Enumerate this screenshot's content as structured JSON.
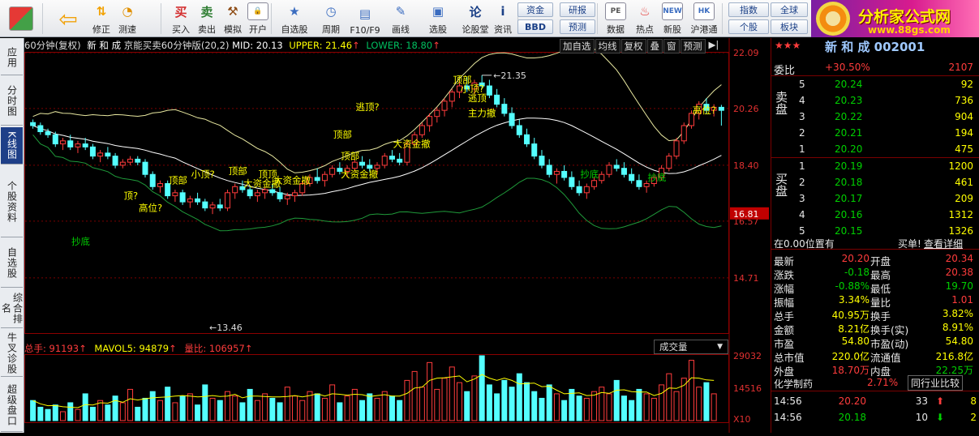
{
  "toolbar": {
    "buttons": [
      {
        "label": "修正",
        "icon": "arrow-up-down-icon"
      },
      {
        "label": "测速",
        "icon": "clock-icon"
      },
      {
        "label": "买入",
        "icon": "buy-icon"
      },
      {
        "label": "卖出",
        "icon": "sell-icon"
      },
      {
        "label": "模拟",
        "icon": "hammer-icon"
      },
      {
        "label": "开户",
        "icon": "lock-icon"
      },
      {
        "label": "自选股",
        "icon": "star-icon"
      },
      {
        "label": "周期",
        "icon": "clock-icon"
      },
      {
        "label": "F10/F9",
        "icon": "f10-icon"
      },
      {
        "label": "画线",
        "icon": "pen-icon"
      },
      {
        "label": "选股",
        "icon": "chart-select-icon"
      },
      {
        "label": "论股堂",
        "icon": "forum-icon"
      },
      {
        "label": "资讯",
        "icon": "info-icon"
      },
      {
        "label": "数据",
        "icon": "pe-icon"
      },
      {
        "label": "热点",
        "icon": "fire-icon"
      },
      {
        "label": "新股",
        "icon": "newstock-icon"
      },
      {
        "label": "沪港通",
        "icon": "hk-icon"
      }
    ],
    "small_buttons": [
      "资金",
      "BBD",
      "研报",
      "预测",
      "指数",
      "个股",
      "全球",
      "板块"
    ],
    "brand_title": "分析家公式网",
    "brand_url": "www.88gs.com",
    "zoom_icons": [
      "×",
      "1",
      "2",
      "3"
    ]
  },
  "sidebar": [
    "应用",
    "分时图",
    "K线图",
    "个股资料",
    "自选股",
    "综合排名",
    "牛叉诊股",
    "超级盘口"
  ],
  "chart_header": {
    "period": "60分钟(复权)",
    "stock": "新 和 成",
    "indicator": "京能买卖60分钟版(20,2)",
    "mid": "MID: 20.13",
    "upper": "UPPER: 21.46",
    "lower": "LOWER: 18.80",
    "buttons": [
      "加自选",
      "均线",
      "复权",
      "叠",
      "窗",
      "预测"
    ]
  },
  "price_axis": [
    "22.09",
    "20.26",
    "18.40",
    "16.57",
    "14.71"
  ],
  "current_price_tag": "16.81",
  "annotations": {
    "high": "21.35",
    "low": "13.46"
  },
  "signal_labels": [
    "抄底",
    "顶?",
    "高位?",
    "顶部",
    "小顶?",
    "顶部",
    "大资金撤",
    "顶顶",
    "大资金撤",
    "顶部",
    "逃顶?",
    "顶部",
    "大资金撤",
    "大资金撤",
    "顶部",
    "小顶?",
    "逃顶",
    "主力撤",
    "抄底",
    "抄底",
    "高位?"
  ],
  "volume_header": {
    "total": "总手: 91193",
    "mavol": "MAVOL5: 94879",
    "ratio": "量比: 106957",
    "dropdown": "成交量"
  },
  "volume_axis": [
    "29032",
    "14516",
    "X10"
  ],
  "quote": {
    "title": "新 和 成  002001",
    "weibi": {
      "label": "委比",
      "value": "+30.50%",
      "diff": "2107"
    },
    "sell_label": "卖盘",
    "buy_label": "买盘",
    "sell": [
      [
        "5",
        "20.24",
        "92"
      ],
      [
        "4",
        "20.23",
        "736"
      ],
      [
        "3",
        "20.22",
        "904"
      ],
      [
        "2",
        "20.21",
        "194"
      ],
      [
        "1",
        "20.20",
        "475"
      ]
    ],
    "buy": [
      [
        "1",
        "20.19",
        "1200"
      ],
      [
        "2",
        "20.18",
        "461"
      ],
      [
        "3",
        "20.17",
        "209"
      ],
      [
        "4",
        "20.16",
        "1312"
      ],
      [
        "5",
        "20.15",
        "1326"
      ]
    ],
    "position": "在0.00位置有",
    "buy_one": "买单!",
    "detail": "查看详细",
    "stats_left": [
      [
        "最新",
        "20.20"
      ],
      [
        "涨跌",
        "-0.18"
      ],
      [
        "涨幅",
        "-0.88%"
      ],
      [
        "振幅",
        "3.34%"
      ],
      [
        "总手",
        "40.95万"
      ],
      [
        "金额",
        "8.21亿"
      ],
      [
        "市盈",
        "54.80"
      ],
      [
        "总市值",
        "220.0亿"
      ],
      [
        "外盘",
        "18.70万"
      ]
    ],
    "stats_right": [
      [
        "开盘",
        "20.34"
      ],
      [
        "最高",
        "20.38"
      ],
      [
        "最低",
        "19.70"
      ],
      [
        "量比",
        "1.01"
      ],
      [
        "换手",
        "3.82%"
      ],
      [
        "换手(实)",
        "8.91%"
      ],
      [
        "市盈(动)",
        "54.80"
      ],
      [
        "流通值",
        "216.8亿"
      ],
      [
        "内盘",
        "22.25万"
      ]
    ],
    "industry": {
      "name": "化学制药",
      "pct": "2.71%",
      "compare": "同行业比较"
    },
    "ticks": [
      [
        "14:56",
        "20.20",
        "33",
        "8"
      ],
      [
        "14:56",
        "20.18",
        "10",
        "2"
      ]
    ]
  },
  "chart_data": {
    "type": "candlestick",
    "price_range": [
      12.9,
      22.09
    ],
    "volume_range": [
      0,
      29032
    ],
    "candles": [
      [
        19.8,
        19.9,
        19.6,
        19.7
      ],
      [
        19.7,
        19.8,
        19.4,
        19.5
      ],
      [
        19.5,
        19.6,
        19.3,
        19.4
      ],
      [
        19.4,
        19.5,
        19.0,
        19.1
      ],
      [
        19.1,
        19.3,
        18.9,
        19.2
      ],
      [
        19.2,
        19.4,
        18.9,
        19.0
      ],
      [
        19.0,
        19.2,
        18.8,
        19.1
      ],
      [
        19.1,
        19.3,
        18.9,
        19.0
      ],
      [
        19.0,
        19.1,
        18.6,
        18.7
      ],
      [
        18.7,
        18.9,
        18.5,
        18.8
      ],
      [
        18.8,
        19.0,
        18.6,
        18.7
      ],
      [
        18.7,
        18.8,
        18.3,
        18.4
      ],
      [
        18.4,
        18.6,
        18.3,
        18.5
      ],
      [
        18.5,
        18.7,
        18.4,
        18.6
      ],
      [
        18.6,
        18.7,
        18.4,
        18.5
      ],
      [
        18.5,
        18.6,
        18.0,
        18.1
      ],
      [
        18.1,
        18.2,
        17.6,
        17.7
      ],
      [
        17.7,
        17.9,
        17.5,
        17.8
      ],
      [
        17.8,
        17.9,
        17.3,
        17.4
      ],
      [
        17.4,
        17.6,
        17.2,
        17.5
      ],
      [
        17.5,
        17.6,
        17.1,
        17.2
      ],
      [
        17.2,
        17.4,
        17.0,
        17.3
      ],
      [
        17.3,
        17.5,
        17.1,
        17.2
      ],
      [
        17.2,
        17.3,
        16.9,
        17.0
      ],
      [
        17.0,
        17.2,
        16.8,
        17.1
      ],
      [
        17.1,
        17.3,
        16.9,
        17.0
      ],
      [
        17.0,
        17.6,
        16.9,
        17.5
      ],
      [
        17.5,
        17.8,
        17.3,
        17.7
      ],
      [
        17.7,
        17.9,
        17.5,
        17.6
      ],
      [
        17.6,
        17.7,
        17.3,
        17.4
      ],
      [
        17.4,
        17.6,
        17.2,
        17.5
      ],
      [
        17.5,
        17.7,
        17.3,
        17.6
      ],
      [
        17.6,
        17.8,
        17.4,
        17.5
      ],
      [
        17.5,
        17.7,
        17.2,
        17.3
      ],
      [
        17.3,
        17.5,
        17.1,
        17.4
      ],
      [
        17.4,
        17.6,
        17.2,
        17.5
      ],
      [
        17.5,
        17.9,
        17.4,
        17.8
      ],
      [
        17.8,
        18.1,
        17.7,
        18.0
      ],
      [
        18.0,
        18.3,
        17.8,
        17.9
      ],
      [
        17.9,
        18.2,
        17.7,
        18.1
      ],
      [
        18.1,
        18.4,
        18.0,
        18.3
      ],
      [
        18.3,
        18.5,
        18.1,
        18.2
      ],
      [
        18.2,
        18.4,
        18.0,
        18.3
      ],
      [
        18.3,
        18.6,
        18.2,
        18.5
      ],
      [
        18.5,
        18.7,
        18.3,
        18.4
      ],
      [
        18.4,
        18.6,
        18.2,
        18.3
      ],
      [
        18.3,
        18.5,
        18.1,
        18.4
      ],
      [
        18.4,
        18.8,
        18.3,
        18.7
      ],
      [
        18.7,
        18.9,
        18.5,
        18.6
      ],
      [
        18.6,
        18.8,
        18.4,
        18.5
      ],
      [
        18.5,
        19.2,
        18.4,
        19.1
      ],
      [
        19.1,
        19.5,
        19.0,
        19.4
      ],
      [
        19.4,
        19.8,
        19.3,
        19.7
      ],
      [
        19.7,
        20.1,
        19.5,
        20.0
      ],
      [
        20.0,
        20.3,
        19.8,
        20.2
      ],
      [
        20.2,
        20.6,
        20.0,
        20.5
      ],
      [
        20.5,
        20.9,
        20.3,
        20.8
      ],
      [
        20.8,
        21.2,
        20.6,
        21.0
      ],
      [
        21.0,
        21.3,
        20.8,
        20.9
      ],
      [
        20.9,
        21.2,
        20.7,
        21.1
      ],
      [
        21.1,
        21.35,
        20.9,
        21.0
      ],
      [
        21.0,
        21.2,
        20.6,
        20.7
      ],
      [
        20.7,
        20.9,
        20.3,
        20.4
      ],
      [
        20.4,
        20.6,
        20.0,
        20.1
      ],
      [
        20.1,
        20.3,
        19.6,
        19.7
      ],
      [
        19.7,
        19.9,
        19.3,
        19.4
      ],
      [
        19.4,
        19.6,
        19.0,
        19.1
      ],
      [
        19.1,
        19.3,
        18.6,
        18.7
      ],
      [
        18.7,
        18.9,
        18.3,
        18.4
      ],
      [
        18.4,
        18.6,
        18.0,
        18.1
      ],
      [
        18.1,
        18.3,
        17.8,
        18.2
      ],
      [
        18.2,
        18.4,
        17.9,
        18.0
      ],
      [
        18.0,
        18.2,
        17.6,
        17.7
      ],
      [
        17.7,
        17.9,
        17.4,
        17.5
      ],
      [
        17.5,
        17.8,
        17.3,
        17.7
      ],
      [
        17.7,
        18.0,
        17.6,
        17.9
      ],
      [
        17.9,
        18.2,
        17.8,
        18.1
      ],
      [
        18.1,
        18.5,
        18.0,
        18.4
      ],
      [
        18.4,
        18.6,
        18.2,
        18.3
      ],
      [
        18.3,
        18.5,
        18.0,
        18.1
      ],
      [
        18.1,
        18.3,
        17.8,
        17.9
      ],
      [
        17.9,
        18.1,
        17.6,
        17.7
      ],
      [
        17.7,
        17.9,
        17.5,
        17.8
      ],
      [
        17.8,
        18.1,
        17.7,
        18.0
      ],
      [
        18.0,
        18.4,
        17.9,
        18.3
      ],
      [
        18.3,
        18.8,
        18.2,
        18.7
      ],
      [
        18.7,
        19.3,
        18.6,
        19.2
      ],
      [
        19.2,
        19.8,
        19.1,
        19.7
      ],
      [
        19.7,
        20.2,
        19.6,
        20.1
      ],
      [
        20.1,
        20.5,
        19.9,
        20.4
      ],
      [
        20.4,
        20.6,
        20.1,
        20.2
      ],
      [
        20.2,
        20.4,
        20.0,
        20.3
      ],
      [
        20.3,
        20.38,
        19.7,
        20.2
      ]
    ],
    "volumes": [
      9000,
      6000,
      5000,
      7000,
      4000,
      8000,
      5000,
      12000,
      6000,
      9000,
      7000,
      11000,
      8000,
      14000,
      6000,
      10000,
      13000,
      9000,
      15000,
      8000,
      11000,
      12000,
      7000,
      16000,
      10000,
      9000,
      13000,
      11000,
      8000,
      14000,
      9000,
      12000,
      10000,
      8000,
      15000,
      11000,
      9000,
      13000,
      12000,
      10000,
      16000,
      8000,
      11000,
      14000,
      9000,
      12000,
      10000,
      13000,
      11000,
      9000,
      18000,
      22000,
      15000,
      26000,
      14000,
      19000,
      24000,
      17000,
      13000,
      20000,
      29032,
      16000,
      12000,
      18000,
      15000,
      21000,
      17000,
      13000,
      10000,
      16000,
      12000,
      9000,
      14000,
      11000,
      10000,
      13000,
      15000,
      12000,
      18000,
      11000,
      9000,
      14000,
      12000,
      10000,
      16000,
      21000,
      13000,
      19000,
      27000,
      15000,
      17000,
      12000
    ]
  }
}
